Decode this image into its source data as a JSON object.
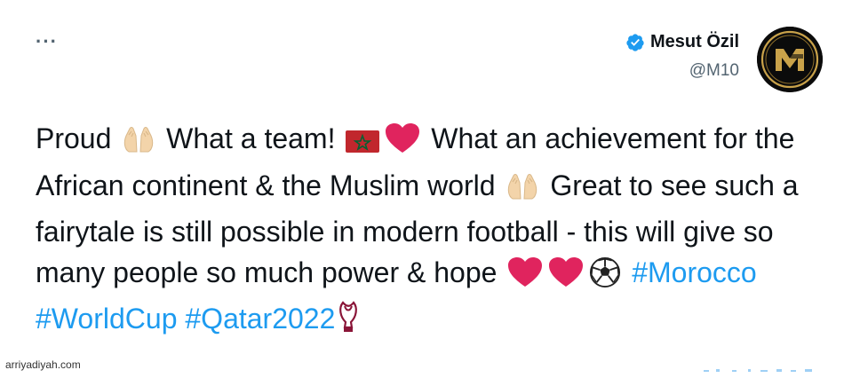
{
  "tweet": {
    "more_label": "···",
    "author": {
      "display_name": "Mesut Özil",
      "handle": "@M10",
      "verified": true
    },
    "text_runs": [
      {
        "t": "Proud ",
        "type": "text"
      },
      {
        "icon": "praying-hands-icon"
      },
      {
        "t": " What a team! ",
        "type": "text"
      },
      {
        "icon": "morocco-flag-icon"
      },
      {
        "icon": "red-heart-icon"
      },
      {
        "t": " What an achievement for the African continent & the Muslim world ",
        "type": "text"
      },
      {
        "icon": "praying-hands-icon"
      },
      {
        "t": " Great to see such a fairytale is still possible in modern football - this will give so many people so much power & hope ",
        "type": "text"
      },
      {
        "icon": "red-heart-icon"
      },
      {
        "icon": "red-heart-icon"
      },
      {
        "icon": "soccer-ball-icon"
      },
      {
        "t": " ",
        "type": "text"
      },
      {
        "t": "#Morocco",
        "type": "hashtag"
      },
      {
        "t": " ",
        "type": "text"
      },
      {
        "t": "#WorldCup",
        "type": "hashtag"
      },
      {
        "t": " ",
        "type": "text"
      },
      {
        "t": "#Qatar2022",
        "type": "hashtag"
      },
      {
        "icon": "world-cup-trophy-icon"
      }
    ]
  },
  "watermark": "arriyadiyah.com",
  "colors": {
    "hashtag": "#1d9bf0",
    "text": "#0f1419",
    "muted": "#536471",
    "verified": "#1d9bf0",
    "heart": "#e0245e",
    "flag_red": "#c1272d",
    "flag_green": "#006233"
  }
}
